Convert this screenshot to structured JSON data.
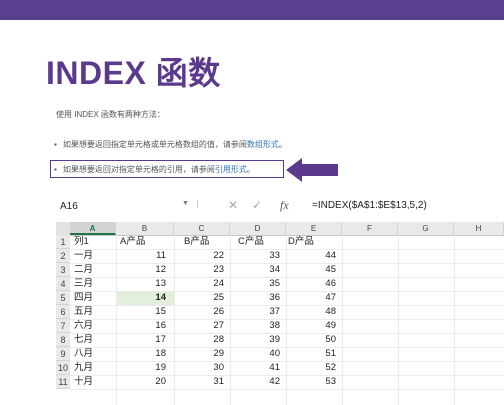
{
  "slide": {
    "title": "INDEX 函数",
    "intro": "使用 INDEX 函数有两种方法：",
    "bullet1_text": "如果想要返回指定单元格或单元格数组的值，请参阅",
    "bullet1_link": "数组形式",
    "bullet1_end": "。",
    "bullet2_text": "如果想要返回对指定单元格的引用，请参阅",
    "bullet2_link": "引用形式",
    "bullet2_end": "。",
    "bullet_symbol": "▪",
    "arrow_icon": "left-arrow-icon",
    "accent_color": "#5b3a8d"
  },
  "formula_bar": {
    "name_box": "A16",
    "formula": "=INDEX($A$1:$E$13,5,2)",
    "cancel_glyph": "✕",
    "enter_glyph": "✓",
    "fx_glyph": "fx"
  },
  "sheet": {
    "columns": [
      "A",
      "B",
      "C",
      "D",
      "E",
      "F",
      "G",
      "H"
    ],
    "header_row": [
      "列1",
      "A产品",
      "B产品",
      "C产品",
      "D产品"
    ],
    "row_numbers": [
      "1",
      "2",
      "3",
      "4",
      "5",
      "6",
      "7",
      "8",
      "9",
      "10",
      "11"
    ],
    "rows": [
      [
        "一月",
        "11",
        "22",
        "33",
        "44"
      ],
      [
        "二月",
        "12",
        "23",
        "34",
        "45"
      ],
      [
        "三月",
        "13",
        "24",
        "35",
        "46"
      ],
      [
        "四月",
        "14",
        "25",
        "36",
        "47"
      ],
      [
        "五月",
        "15",
        "26",
        "37",
        "48"
      ],
      [
        "六月",
        "16",
        "27",
        "38",
        "49"
      ],
      [
        "七月",
        "17",
        "28",
        "39",
        "50"
      ],
      [
        "八月",
        "18",
        "29",
        "40",
        "51"
      ],
      [
        "九月",
        "19",
        "30",
        "41",
        "52"
      ],
      [
        "十月",
        "20",
        "31",
        "42",
        "53"
      ]
    ],
    "highlight_color": "#e2efda"
  }
}
